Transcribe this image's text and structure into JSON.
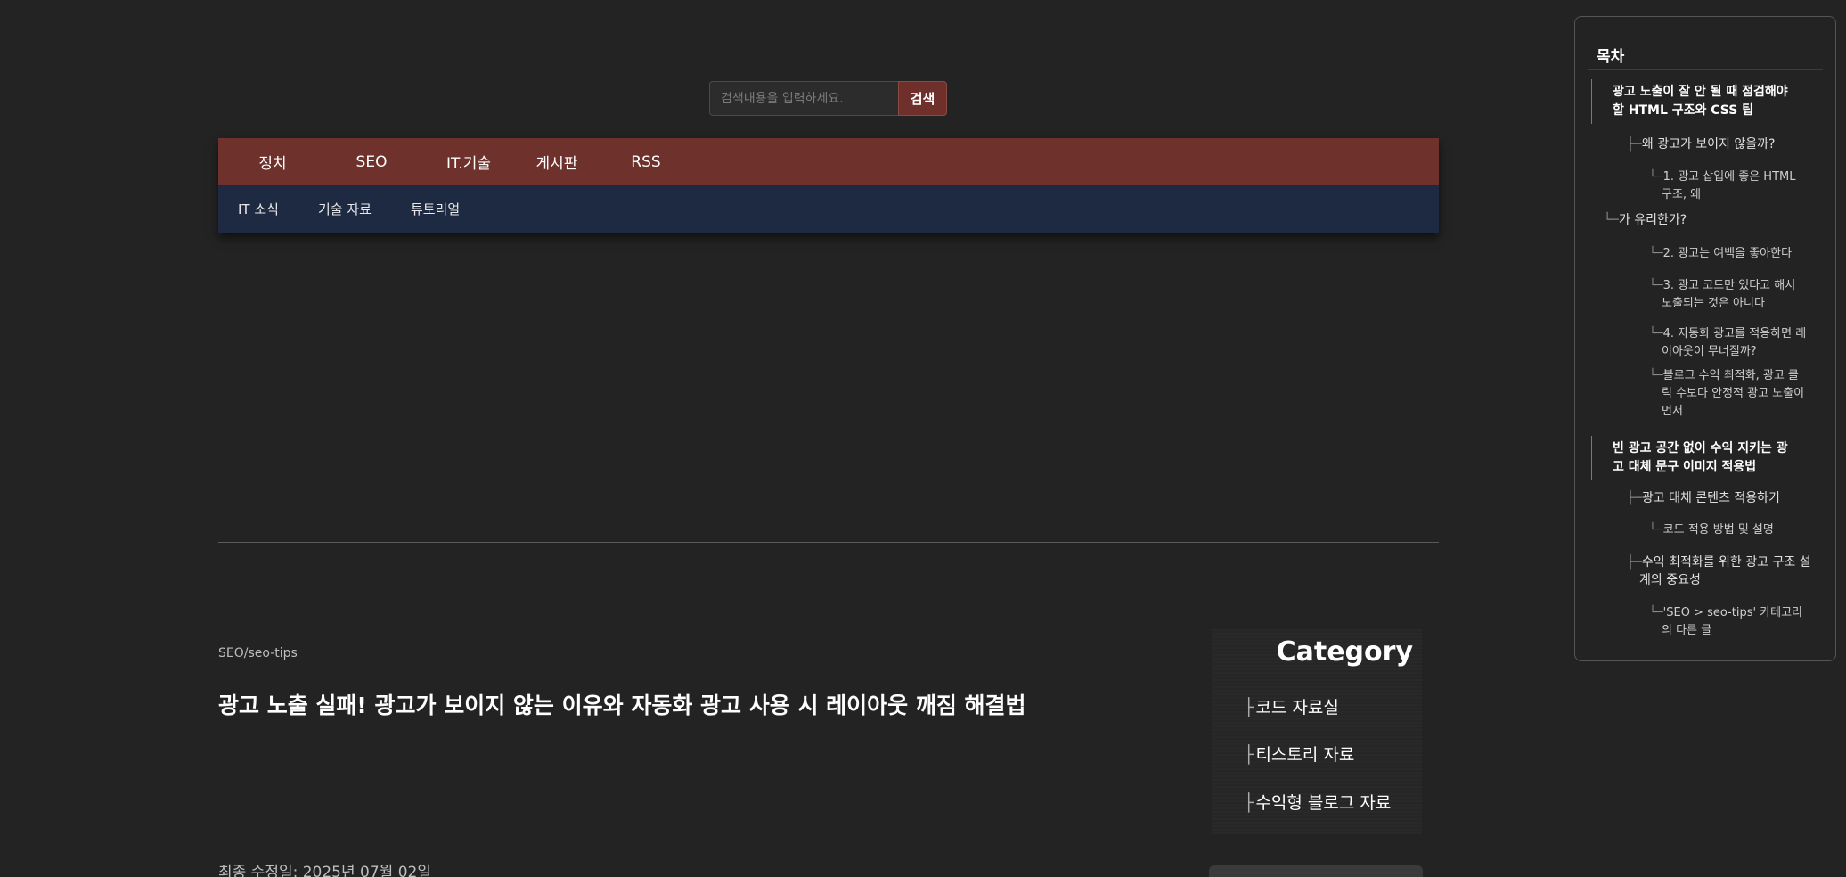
{
  "search": {
    "placeholder": "검색내용을 입력하세요.",
    "button": "검색"
  },
  "nav": {
    "main": [
      "정치",
      "SEO",
      "IT.기술",
      "게시판",
      "RSS"
    ],
    "sub": [
      "IT 소식",
      "기술 자료",
      "튜토리얼"
    ]
  },
  "post": {
    "category": "SEO/seo-tips",
    "title": "광고 노출 실패! 광고가 보이지 않는 이유와 자동화 광고 사용 시 레이아웃 깨짐 해결법",
    "date": "최종 수정일: 2025년 07월 02일"
  },
  "category_box": {
    "title": "Category",
    "items": [
      "코드 자료실",
      "티스토리 자료",
      "수익형 블로그 자료"
    ]
  },
  "toc": {
    "heading": "목차",
    "items": [
      {
        "level": 1,
        "lines": [
          "광고 노출이 잘 안 될 때 점검해야",
          "할 HTML 구조와 CSS 팁"
        ]
      },
      {
        "level": 2,
        "lines": [
          "왜 광고가 보이지 않을까?"
        ]
      },
      {
        "level": 3,
        "lines": [
          "1. 광고 삽입에 좋은 HTML",
          "구조, 왜"
        ]
      },
      {
        "level": 2,
        "lines": [
          "가 유리한가?"
        ]
      },
      {
        "level": 3,
        "lines": [
          "2. 광고는 여백을 좋아한다"
        ]
      },
      {
        "level": 3,
        "lines": [
          "3. 광고 코드만 있다고 해서",
          "노출되는 것은 아니다"
        ]
      },
      {
        "level": 3,
        "lines": [
          "4. 자동화 광고를 적용하면 레",
          "이아웃이 무너질까?"
        ]
      },
      {
        "level": 3,
        "lines": [
          "블로그 수익 최적화, 광고 클",
          "릭 수보다 안정적 광고 노출이",
          "먼저"
        ]
      },
      {
        "level": 1,
        "lines": [
          "빈 광고 공간 없이 수익 지키는 광",
          "고 대체 문구 이미지 적용법"
        ]
      },
      {
        "level": 2,
        "lines": [
          "광고 대체 콘텐츠 적용하기"
        ]
      },
      {
        "level": 3,
        "lines": [
          "코드 적용 방법 및 설명"
        ]
      },
      {
        "level": 2,
        "lines": [
          "수익 최적화를 위한 광고 구조 설",
          "계의 중요성"
        ]
      },
      {
        "level": 3,
        "lines": [
          "'SEO > seo-tips' 카테고리",
          "의 다른 글"
        ]
      }
    ]
  }
}
